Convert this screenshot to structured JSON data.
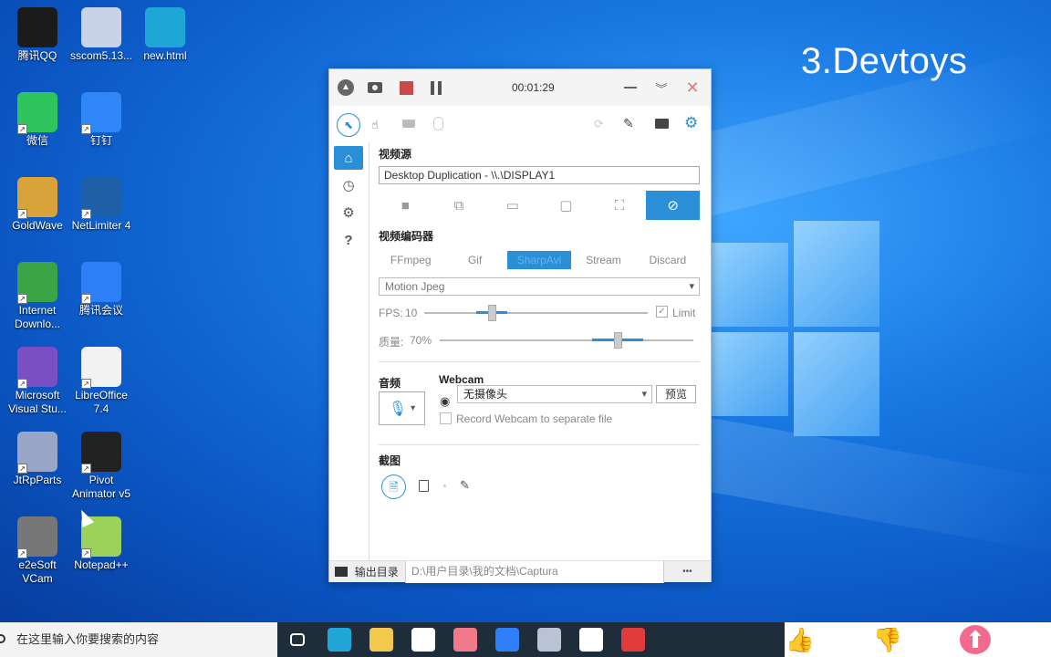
{
  "desktop": {
    "overlay_title": "3.Devtoys",
    "icons": [
      {
        "label": "腾讯QQ",
        "icon": "qq-penguin-icon",
        "color": "#1b1b1b"
      },
      {
        "label": "sscom5.13...",
        "icon": "sscom-building-icon",
        "color": "#c8d2e8"
      },
      {
        "label": "new.html",
        "icon": "edge-browser-icon",
        "color": "#1fa6d8"
      },
      {
        "label": "微信",
        "icon": "wechat-icon",
        "color": "#2ec55d"
      },
      {
        "label": "钉钉",
        "icon": "dingtalk-icon",
        "color": "#2f86f6"
      },
      {
        "label": "GoldWave",
        "icon": "goldwave-icon",
        "color": "#d8a33b"
      },
      {
        "label": "NetLimiter 4",
        "icon": "netlimiter-icon",
        "color": "#1f5fa8"
      },
      {
        "label": "Internet Downlo...",
        "icon": "idm-globe-icon",
        "color": "#3aa546"
      },
      {
        "label": "腾讯会议",
        "icon": "tencent-meeting-icon",
        "color": "#2e7ef7"
      },
      {
        "label": "Microsoft Visual Stu...",
        "icon": "visual-studio-icon",
        "color": "#7a4fc4"
      },
      {
        "label": "LibreOffice 7.4",
        "icon": "libreoffice-doc-icon",
        "color": "#f2f2f2"
      },
      {
        "label": "JtRpParts",
        "icon": "jtrpparts-icon",
        "color": "#9aa6c8"
      },
      {
        "label": "Pivot Animator v5",
        "icon": "pivot-stickman-icon",
        "color": "#222222"
      },
      {
        "label": "e2eSoft VCam",
        "icon": "webcam-icon",
        "color": "#777777"
      },
      {
        "label": "Notepad++",
        "icon": "notepadpp-icon",
        "color": "#9bd25a"
      }
    ]
  },
  "app": {
    "timer": "00:01:29",
    "title_buttons": [
      "collapse",
      "screenshot",
      "stop",
      "pause",
      "minimize",
      "expand",
      "close"
    ],
    "video_source_label": "视频源",
    "video_source_value": "Desktop Duplication - \\\\.\\DISPLAY1",
    "encoder_label": "视频编码器",
    "encoders": [
      "FFmpeg",
      "Gif",
      "SharpAvi",
      "Stream",
      "Discard"
    ],
    "codec_value": "Motion Jpeg",
    "fps_label": "FPS:",
    "fps_value": "10",
    "fps_level": 0.3,
    "limit_label": "Limit",
    "quality_label": "质量:",
    "quality_value": "70%",
    "quality_level": 0.7,
    "audio_label": "音频",
    "webcam_label": "Webcam",
    "webcam_value": "无摄像头",
    "preview_button": "预览",
    "separate_file_label": "Record Webcam to separate file",
    "screenshot_label": "截图",
    "output_dir_label": "输出目录",
    "output_dir_value": "D:\\用户目录\\我的文档\\Captura",
    "more_button": "•••",
    "accent_color": "#2a8fd6"
  },
  "taskbar": {
    "search_placeholder": "在这里输入你要搜索的内容",
    "apps": [
      {
        "icon": "task-view-icon",
        "color": "#ffffff"
      },
      {
        "icon": "edge-browser-icon",
        "color": "#1fa6d8"
      },
      {
        "icon": "file-explorer-icon",
        "color": "#f2c94c"
      },
      {
        "icon": "document-icon",
        "color": "#ffffff"
      },
      {
        "icon": "lala-app-icon",
        "color": "#f07a8a"
      },
      {
        "icon": "tencent-meeting-icon",
        "color": "#2e7ef7"
      },
      {
        "icon": "network-monitor-icon",
        "color": "#b9c3d4"
      },
      {
        "icon": "typora-icon",
        "color": "#ffffff"
      },
      {
        "icon": "captura-record-icon",
        "color": "#e23b3b"
      }
    ]
  },
  "reactions": [
    {
      "icon": "thumbs-up-icon",
      "color": "#f26a8d"
    },
    {
      "icon": "thumbs-down-icon",
      "color": "#777777"
    },
    {
      "icon": "share-arrow-icon",
      "color": "#f26a8d"
    }
  ]
}
